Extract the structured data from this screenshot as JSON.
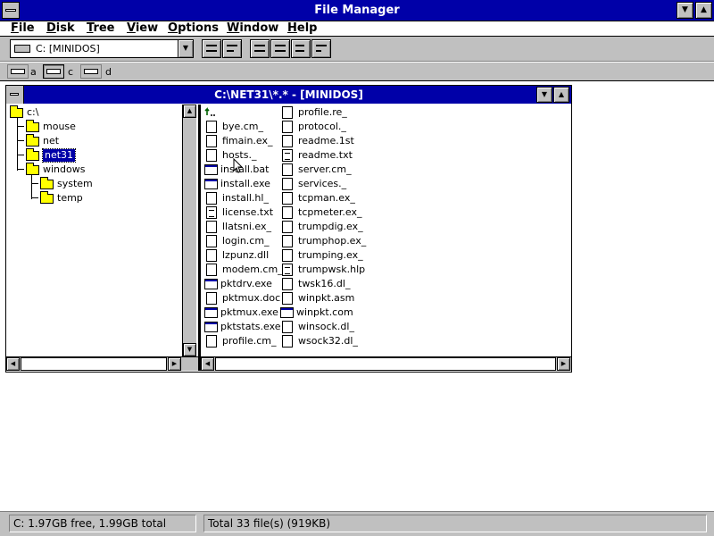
{
  "window": {
    "title": "File Manager"
  },
  "menu": [
    "File",
    "Disk",
    "Tree",
    "View",
    "Options",
    "Window",
    "Help"
  ],
  "toolbar": {
    "drive_combo_value": "C: [MINIDOS]"
  },
  "drives": [
    {
      "letter": "a",
      "type": "floppy-drive-icon"
    },
    {
      "letter": "c",
      "type": "hard-drive-icon",
      "selected": true
    },
    {
      "letter": "d",
      "type": "cdrom-drive-icon"
    }
  ],
  "child_window": {
    "title": "C:\\NET31\\*.* - [MINIDOS]"
  },
  "tree": [
    {
      "label": "c:\\",
      "level": 0
    },
    {
      "label": "mouse",
      "level": 1
    },
    {
      "label": "net",
      "level": 1
    },
    {
      "label": "net31",
      "level": 1,
      "selected": true,
      "open": true
    },
    {
      "label": "windows",
      "level": 1
    },
    {
      "label": "system",
      "level": 2
    },
    {
      "label": "temp",
      "level": 2
    }
  ],
  "files_col1": [
    {
      "name": "",
      "icon": "up-directory-icon"
    },
    {
      "name": "bye.cm_",
      "icon": "file-icon"
    },
    {
      "name": "fimain.ex_",
      "icon": "file-icon"
    },
    {
      "name": "hosts._",
      "icon": "file-icon"
    },
    {
      "name": "install.bat",
      "icon": "program-icon"
    },
    {
      "name": "install.exe",
      "icon": "program-icon"
    },
    {
      "name": "install.hl_",
      "icon": "file-icon"
    },
    {
      "name": "license.txt",
      "icon": "document-icon"
    },
    {
      "name": "llatsni.ex_",
      "icon": "file-icon"
    },
    {
      "name": "login.cm_",
      "icon": "file-icon"
    },
    {
      "name": "lzpunz.dll",
      "icon": "file-icon"
    },
    {
      "name": "modem.cm_",
      "icon": "file-icon"
    },
    {
      "name": "pktdrv.exe",
      "icon": "program-icon"
    },
    {
      "name": "pktmux.doc",
      "icon": "file-icon"
    },
    {
      "name": "pktmux.exe",
      "icon": "program-icon"
    },
    {
      "name": "pktstats.exe",
      "icon": "program-icon"
    },
    {
      "name": "profile.cm_",
      "icon": "file-icon"
    }
  ],
  "files_col2": [
    {
      "name": "profile.re_",
      "icon": "file-icon"
    },
    {
      "name": "protocol._",
      "icon": "file-icon"
    },
    {
      "name": "readme.1st",
      "icon": "file-icon"
    },
    {
      "name": "readme.txt",
      "icon": "document-icon"
    },
    {
      "name": "server.cm_",
      "icon": "file-icon"
    },
    {
      "name": "services._",
      "icon": "file-icon"
    },
    {
      "name": "tcpman.ex_",
      "icon": "file-icon"
    },
    {
      "name": "tcpmeter.ex_",
      "icon": "file-icon"
    },
    {
      "name": "trumpdig.ex_",
      "icon": "file-icon"
    },
    {
      "name": "trumphop.ex_",
      "icon": "file-icon"
    },
    {
      "name": "trumping.ex_",
      "icon": "file-icon"
    },
    {
      "name": "trumpwsk.hlp",
      "icon": "document-icon"
    },
    {
      "name": "twsk16.dl_",
      "icon": "file-icon"
    },
    {
      "name": "winpkt.asm",
      "icon": "file-icon"
    },
    {
      "name": "winpkt.com",
      "icon": "program-icon"
    },
    {
      "name": "winsock.dl_",
      "icon": "file-icon"
    },
    {
      "name": "wsock32.dl_",
      "icon": "file-icon"
    }
  ],
  "status": {
    "disk_free": "C: 1.97GB free,  1.99GB total",
    "file_summary": "Total 33 file(s) (919KB)"
  },
  "colors": {
    "titlebar": "#0000a8",
    "chrome": "#c0c0c0",
    "folder": "#ffff00"
  }
}
